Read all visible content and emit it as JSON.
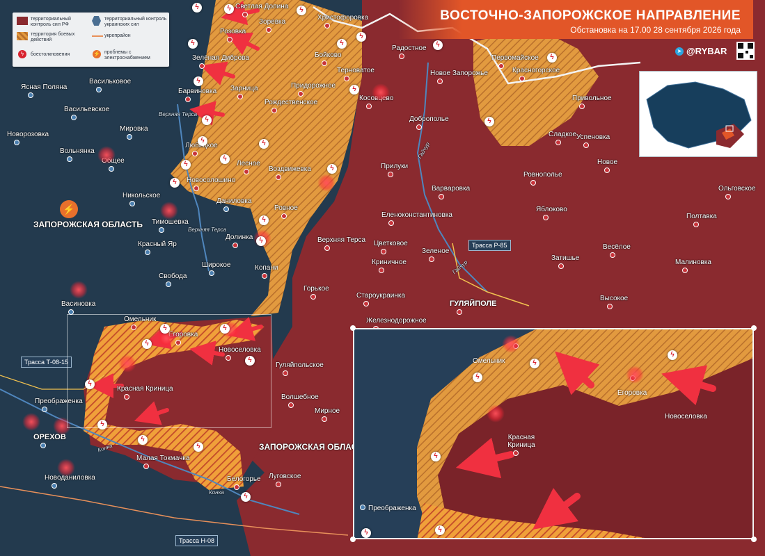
{
  "header": {
    "title": "ВОСТОЧНО-ЗАПОРОЖСКОЕ НАПРАВЛЕНИЕ",
    "subtitle": "Обстановка на 17.00 28 сентября 2026 года"
  },
  "brand": {
    "handle": "@RYBAR",
    "icon": "telegram-icon"
  },
  "legend": {
    "items": [
      {
        "text": "территориальный контроль сил РФ",
        "icon": "ru-control-swatch"
      },
      {
        "text": "территориальный контроль украинских сил",
        "icon": "ua-control-hexagon"
      },
      {
        "text": "территория боевых действий",
        "icon": "contested-swatch"
      },
      {
        "text": "укрепрайон",
        "icon": "fortification-line"
      },
      {
        "text": "боестолкновения",
        "icon": "clash-icon"
      },
      {
        "text": "проблемы с электроснабжением",
        "icon": "power-outage-icon"
      }
    ]
  },
  "colors": {
    "ru": "#8a2a2f",
    "ua": "#263f58",
    "contested": "#e29a3f",
    "accent": "#e25628",
    "clash": "#d8222e"
  },
  "regions": {
    "main": "ЗАПОРОЖСКАЯ ОБЛАСТЬ",
    "south": "ЗАПОРОЖСКАЯ ОБЛАСТЬ"
  },
  "rivers": [
    "Верхняя Терса",
    "Верхняя Терса",
    "Гайчур",
    "Гайчур",
    "Конка",
    "Конка"
  ],
  "routes": [
    "Трасса Т-08-15",
    "Трасса Р-85",
    "Трасса Н-08"
  ],
  "places": [
    {
      "name": "Светлая Долина",
      "side": "ru"
    },
    {
      "name": "Христофоровка",
      "side": "ru"
    },
    {
      "name": "Зоревка",
      "side": "ru"
    },
    {
      "name": "Розовка",
      "side": "ru"
    },
    {
      "name": "Радостное",
      "side": "ru"
    },
    {
      "name": "Бойково",
      "side": "ru"
    },
    {
      "name": "Первомайское",
      "side": "ru"
    },
    {
      "name": "Зелёная Диброва",
      "side": "ru"
    },
    {
      "name": "Терноватое",
      "side": "ru"
    },
    {
      "name": "Красногорское",
      "side": "ru"
    },
    {
      "name": "Ясная Поляна",
      "side": "ua"
    },
    {
      "name": "Васильковое",
      "side": "ua"
    },
    {
      "name": "Барвиновка",
      "side": "ru"
    },
    {
      "name": "Зарница",
      "side": "ru"
    },
    {
      "name": "Придорожное",
      "side": "ru"
    },
    {
      "name": "Новое Запорожье",
      "side": "ru"
    },
    {
      "name": "Косовцево",
      "side": "ru"
    },
    {
      "name": "Васильевское",
      "side": "ua"
    },
    {
      "name": "Рождественское",
      "side": "ru"
    },
    {
      "name": "Привольное",
      "side": "ru"
    },
    {
      "name": "Мировка",
      "side": "ua"
    },
    {
      "name": "Доброполье",
      "side": "ru"
    },
    {
      "name": "Сладкое",
      "side": "ru"
    },
    {
      "name": "Новорозовка",
      "side": "ua"
    },
    {
      "name": "Любицкое",
      "side": "ru"
    },
    {
      "name": "Вольнянка",
      "side": "ua"
    },
    {
      "name": "Успеновка",
      "side": "ru"
    },
    {
      "name": "Общее",
      "side": "ua"
    },
    {
      "name": "Лесное",
      "side": "ru"
    },
    {
      "name": "Новое",
      "side": "ru"
    },
    {
      "name": "Прилуки",
      "side": "ru"
    },
    {
      "name": "Воздвижевка",
      "side": "ru"
    },
    {
      "name": "Новосолошино",
      "side": "ru"
    },
    {
      "name": "Варваровка",
      "side": "ru"
    },
    {
      "name": "Ровнополье",
      "side": "ru"
    },
    {
      "name": "Ольговское",
      "side": "ru"
    },
    {
      "name": "Никольское",
      "side": "ua"
    },
    {
      "name": "Даниловка",
      "side": "ua"
    },
    {
      "name": "Яблоково",
      "side": "ru"
    },
    {
      "name": "Ровное",
      "side": "ru"
    },
    {
      "name": "Тимошевка",
      "side": "ua"
    },
    {
      "name": "Еленоконстантиновка",
      "side": "ru"
    },
    {
      "name": "Полтавка",
      "side": "ru"
    },
    {
      "name": "Долинка",
      "side": "ru"
    },
    {
      "name": "Верхняя Терса",
      "side": "ru"
    },
    {
      "name": "Красный Яр",
      "side": "ua"
    },
    {
      "name": "Цветковое",
      "side": "ru"
    },
    {
      "name": "Зеленое",
      "side": "ru"
    },
    {
      "name": "Весёлое",
      "side": "ru"
    },
    {
      "name": "Широкое",
      "side": "ua"
    },
    {
      "name": "Копани",
      "side": "ru"
    },
    {
      "name": "Криничное",
      "side": "ru"
    },
    {
      "name": "Затишье",
      "side": "ru"
    },
    {
      "name": "Малиновка",
      "side": "ru"
    },
    {
      "name": "Свобода",
      "side": "ua"
    },
    {
      "name": "Горькое",
      "side": "ru"
    },
    {
      "name": "Староукраинка",
      "side": "ru"
    },
    {
      "name": "Высокое",
      "side": "ru"
    },
    {
      "name": "Васиновка",
      "side": "ua"
    },
    {
      "name": "ГУЛЯЙПОЛЕ",
      "side": "ru"
    },
    {
      "name": "Железнодорожное",
      "side": "ru"
    },
    {
      "name": "Омельник",
      "side": "ru"
    },
    {
      "name": "Егоровка",
      "side": "ru"
    },
    {
      "name": "Новоселовка",
      "side": "ru"
    },
    {
      "name": "Гуляйпольское",
      "side": "ru"
    },
    {
      "name": "Красная Криница",
      "side": "ru"
    },
    {
      "name": "Преображенка",
      "side": "ua"
    },
    {
      "name": "Волшебное",
      "side": "ru"
    },
    {
      "name": "Мирное",
      "side": "ru"
    },
    {
      "name": "ОРЕХОВ",
      "side": "ua"
    },
    {
      "name": "Малая Токмачка",
      "side": "ru"
    },
    {
      "name": "Новоданиловка",
      "side": "ua"
    },
    {
      "name": "Белогорье",
      "side": "ru"
    },
    {
      "name": "Луговское",
      "side": "ru"
    }
  ],
  "zoom": {
    "places": [
      "Омельник",
      "Егоровка",
      "Новоселовка",
      "Красная Криница",
      "Преображенка"
    ]
  }
}
